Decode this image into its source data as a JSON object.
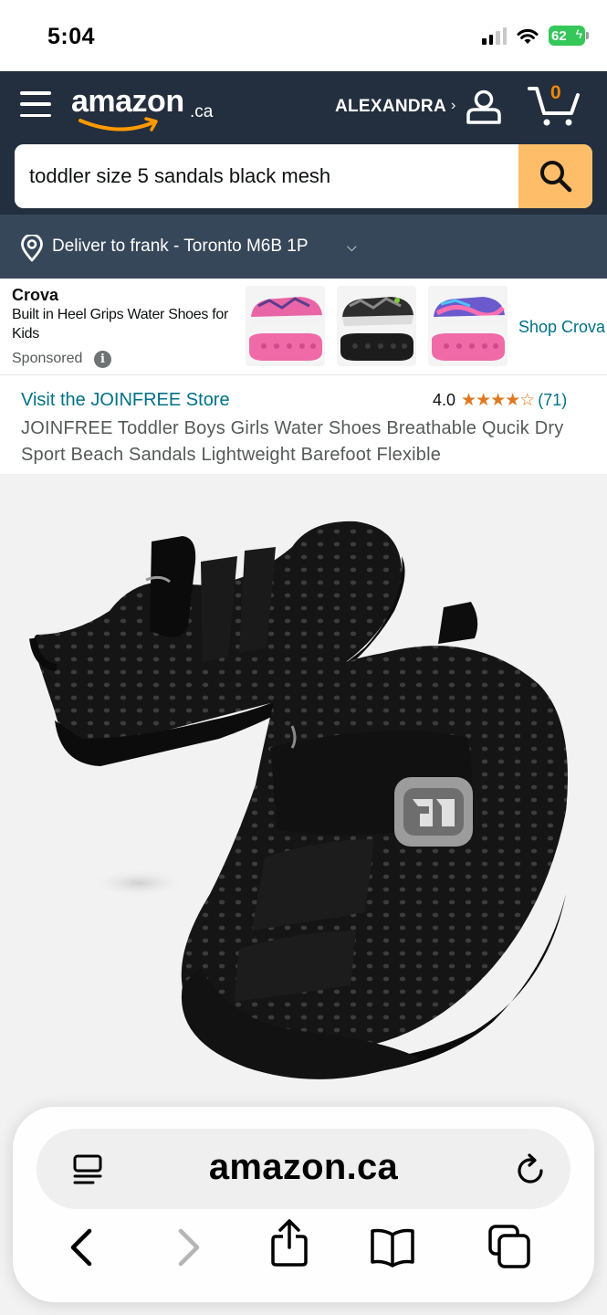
{
  "status_bar": {
    "time": "5:04",
    "battery": "62",
    "icons": [
      "cellular-signal-icon",
      "wifi-icon",
      "battery-charging-icon"
    ]
  },
  "header": {
    "logo_text": "amazon",
    "logo_suffix": ".ca",
    "account_name": "ALEXANDRA",
    "account_chevron": "›",
    "cart_count": "0",
    "icons": [
      "menu-icon",
      "user-icon",
      "cart-icon"
    ]
  },
  "search": {
    "value": "toddler size 5 sandals black mesh",
    "button_icon": "search-icon"
  },
  "delivery": {
    "text": "Deliver to frank - Toronto M6B 1P",
    "chevron": "⌵"
  },
  "sponsored_banner": {
    "brand": "Crova",
    "tagline": "Built in Heel Grips Water Shoes for Kids",
    "label": "Sponsored",
    "info": "i",
    "cta": "Shop Crova"
  },
  "product": {
    "store_link": "Visit the JOINFREE Store",
    "rating_value": "4.0",
    "stars": "★★★★☆",
    "review_count": "(71)",
    "title": "JOINFREE Toddler Boys Girls Water Shoes Breathable Qucik Dry Sport Beach Sandals Lightweight Barefoot Flexible"
  },
  "safari": {
    "url": "amazon.ca",
    "icons": [
      "reader-mode-icon",
      "reload-icon",
      "back-icon",
      "forward-icon",
      "share-icon",
      "bookmarks-icon",
      "tabs-icon"
    ]
  },
  "colors": {
    "header_bg": "#232f3e",
    "deliver_bg": "#37475a",
    "search_button": "#febd69",
    "link": "#007185",
    "star": "#de7921",
    "cart_count": "#f08804",
    "battery": "#34c759"
  }
}
